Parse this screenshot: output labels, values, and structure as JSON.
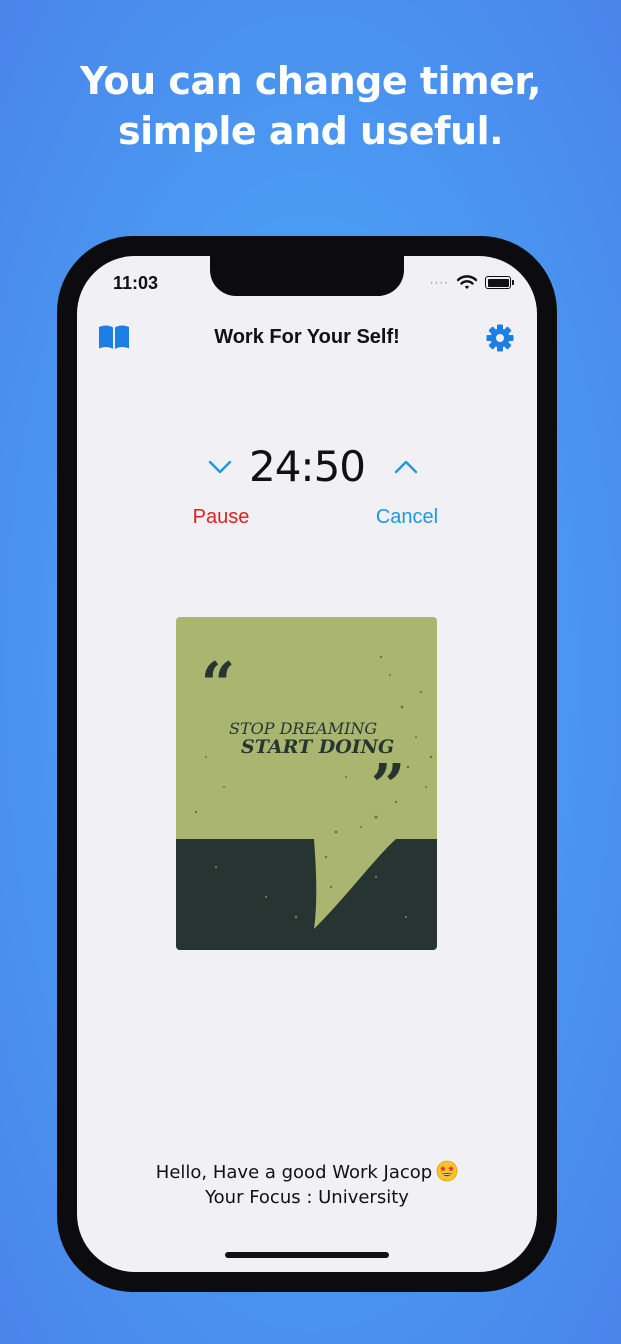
{
  "headline": {
    "line1": "You can change timer,",
    "line2": "simple and useful."
  },
  "status_bar": {
    "time": "11:03",
    "signal_dots": "····"
  },
  "nav": {
    "title": "Work For Your Self!",
    "left_icon": "book-icon",
    "right_icon": "gear-icon"
  },
  "timer": {
    "value": "24:50",
    "pause_label": "Pause",
    "cancel_label": "Cancel"
  },
  "poster": {
    "line1": "STOP DREAMING",
    "line2": "START DOING",
    "open_quote": "“",
    "close_quote": "”"
  },
  "footer": {
    "greeting": "Hello, Have a good Work Jacop",
    "focus": "Your Focus : University"
  },
  "colors": {
    "background": "#4a9cf3",
    "accent_blue": "#1b7fe3",
    "pause_red": "#e0201f",
    "cancel_blue": "#1b9ae3",
    "poster_olive": "#aab66f",
    "poster_dark": "#263532"
  }
}
